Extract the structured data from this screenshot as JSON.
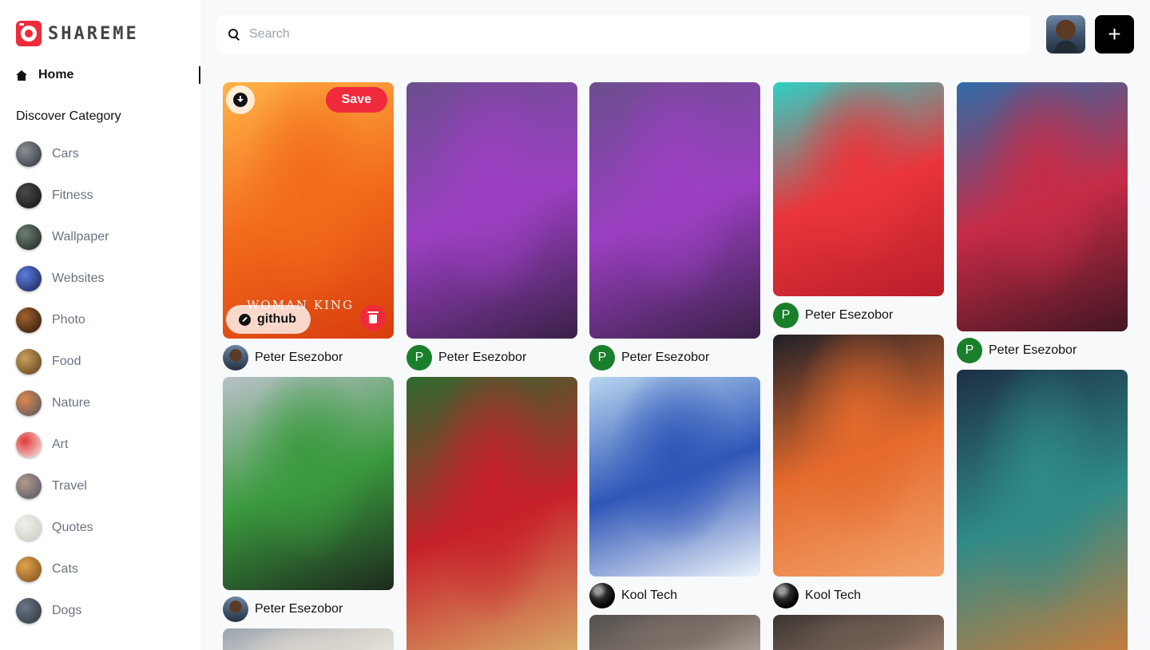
{
  "app": {
    "name": "SHAREME"
  },
  "sidebar": {
    "home_label": "Home",
    "discover_title": "Discover Category",
    "categories": [
      {
        "label": "Cars",
        "colors": [
          "#8a8f96",
          "#2f3338"
        ]
      },
      {
        "label": "Fitness",
        "colors": [
          "#4a4a4a",
          "#111111"
        ]
      },
      {
        "label": "Wallpaper",
        "colors": [
          "#6f7f72",
          "#1c2320"
        ]
      },
      {
        "label": "Websites",
        "colors": [
          "#5a7de0",
          "#1a1f4d"
        ]
      },
      {
        "label": "Photo",
        "colors": [
          "#a0612f",
          "#2a160c"
        ]
      },
      {
        "label": "Food",
        "colors": [
          "#c8a15a",
          "#5a3b1c"
        ]
      },
      {
        "label": "Nature",
        "colors": [
          "#e0894a",
          "#4a5565"
        ]
      },
      {
        "label": "Art",
        "colors": [
          "#e23a3a",
          "#f2efe9"
        ]
      },
      {
        "label": "Travel",
        "colors": [
          "#b4998a",
          "#4d5566"
        ]
      },
      {
        "label": "Quotes",
        "colors": [
          "#f1f1ec",
          "#c9c9bf"
        ]
      },
      {
        "label": "Cats",
        "colors": [
          "#e0a24a",
          "#7a4e1d"
        ]
      },
      {
        "label": "Dogs",
        "colors": [
          "#6a7787",
          "#2d333b"
        ]
      }
    ]
  },
  "search": {
    "placeholder": "Search"
  },
  "header": {
    "add_icon": "+",
    "user_avatar": "user-avatar"
  },
  "pins": [
    {
      "user": "Peter Esezobor",
      "avatar_type": "photo",
      "image_colors": [
        "#ffb347",
        "#f26a1b",
        "#d83d0e"
      ],
      "image_text": "WOMAN KING",
      "hovered": true,
      "save_label": "Save",
      "link_label": "github"
    },
    {
      "user": "Peter Esezobor",
      "avatar_type": "initial",
      "initial": "P",
      "image_colors": [
        "#6b4e8e",
        "#9b3fc2",
        "#3a2148"
      ]
    },
    {
      "user": "Peter Esezobor",
      "avatar_type": "initial",
      "initial": "P",
      "image_colors": [
        "#6b4e8e",
        "#9b3fc2",
        "#3a2148"
      ]
    },
    {
      "user": "Peter Esezobor",
      "avatar_type": "initial",
      "initial": "P",
      "image_colors": [
        "#2ed1c6",
        "#e9353b",
        "#b91e2a"
      ]
    },
    {
      "user": "Peter Esezobor",
      "avatar_type": "initial",
      "initial": "P",
      "image_colors": [
        "#2f6ca8",
        "#c72b46",
        "#421623"
      ]
    },
    {
      "user": "Peter Esezobor",
      "avatar_type": "photo",
      "image_colors": [
        "#b9c1c9",
        "#3a9a3e",
        "#1d2a1d"
      ]
    },
    {
      "user": "",
      "avatar_type": "none",
      "image_colors": [
        "#2e6b2e",
        "#c7202a",
        "#d8b26a"
      ]
    },
    {
      "user": "Kool Tech",
      "avatar_type": "ball",
      "image_colors": [
        "#b8d6ef",
        "#2f56b8",
        "#eef4fa"
      ]
    },
    {
      "user": "Kool Tech",
      "avatar_type": "ball",
      "image_colors": [
        "#1e2028",
        "#e56a2c",
        "#f2a36b"
      ]
    },
    {
      "user": "",
      "avatar_type": "none",
      "image_colors": [
        "#1d2f45",
        "#2f8b88",
        "#c97b3a"
      ]
    },
    {
      "user": "",
      "avatar_type": "none",
      "image_colors": [
        "#9aa4b0",
        "#d6d2cc",
        "#f0ede8"
      ]
    },
    {
      "user": "",
      "avatar_type": "none",
      "image_colors": [
        "#54504e",
        "#7a6e66",
        "#b7aca4"
      ]
    },
    {
      "user": "",
      "avatar_type": "none",
      "image_colors": [
        "#3b3431",
        "#6b5a50",
        "#a08470"
      ]
    }
  ],
  "colors": {
    "accent": "#ef2a3a",
    "initial_avatar": "#1a7f2a",
    "sidebar_bg": "#ffffff",
    "page_bg": "#f8f9fb"
  }
}
